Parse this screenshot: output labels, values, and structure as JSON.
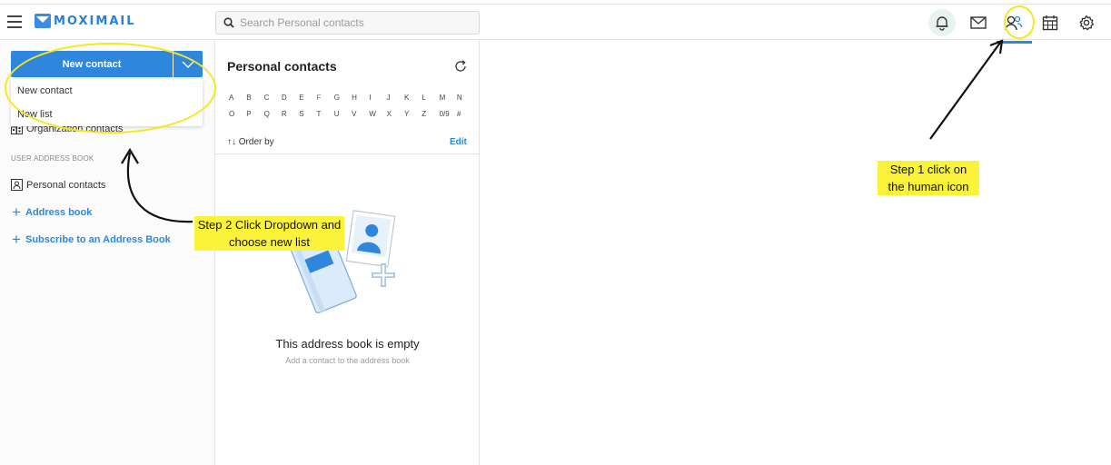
{
  "app": {
    "logo_text": "MOXIMAIL",
    "brand_color": "#2f86dd"
  },
  "search": {
    "placeholder": "Search Personal contacts"
  },
  "topbar": {
    "icons": [
      "bell-icon",
      "mail-icon",
      "contacts-icon",
      "calendar-icon",
      "gear-icon"
    ],
    "active": "contacts-icon"
  },
  "sidebar": {
    "new_contact_label": "New contact",
    "menu": [
      {
        "label": "New contact"
      },
      {
        "label": "New list"
      }
    ],
    "org_contacts_label": "Organization contacts",
    "section_user_address_book": "USER ADDRESS BOOK",
    "personal_contacts_label": "Personal contacts",
    "address_book_label": "Address book",
    "subscribe_label": "Subscribe to an Address Book"
  },
  "panel": {
    "title": "Personal contacts",
    "alphabet_row1": [
      "A",
      "B",
      "C",
      "D",
      "E",
      "F",
      "G",
      "H",
      "I",
      "J",
      "K",
      "L",
      "M",
      "N"
    ],
    "alphabet_row2": [
      "O",
      "P",
      "Q",
      "R",
      "S",
      "T",
      "U",
      "V",
      "W",
      "X",
      "Y",
      "Z",
      "0/9",
      "#"
    ],
    "order_by_label": "Order by",
    "edit_label": "Edit",
    "empty_title": "This address book is empty",
    "empty_subtitle": "Add a contact to the address book"
  },
  "annotations": {
    "step1": "Step 1 click on the human icon",
    "step2": "Step 2 Click Dropdown and choose new list",
    "highlight_color": "#f2ea1a"
  }
}
